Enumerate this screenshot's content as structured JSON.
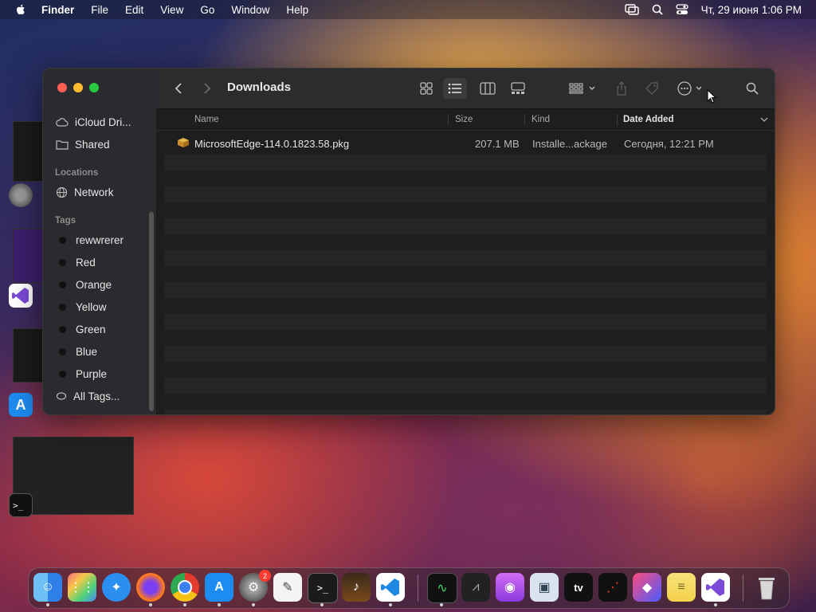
{
  "menubar": {
    "app_name": "Finder",
    "items": [
      "File",
      "Edit",
      "View",
      "Go",
      "Window",
      "Help"
    ],
    "clock": "Чт, 29 июня  1:06 PM"
  },
  "finder": {
    "title": "Downloads",
    "sidebar": {
      "favorites": [
        {
          "label": "iCloud Dri...",
          "icon": "cloud-icon"
        },
        {
          "label": "Shared",
          "icon": "shared-folder-icon"
        }
      ],
      "locations_header": "Locations",
      "locations": [
        {
          "label": "Network",
          "icon": "globe-icon"
        }
      ],
      "tags_header": "Tags",
      "tags": [
        {
          "label": "rewwrerer"
        },
        {
          "label": "Red"
        },
        {
          "label": "Orange"
        },
        {
          "label": "Yellow"
        },
        {
          "label": "Green"
        },
        {
          "label": "Blue"
        },
        {
          "label": "Purple"
        },
        {
          "label": "All Tags..."
        }
      ]
    },
    "columns": {
      "name": "Name",
      "size": "Size",
      "kind": "Kind",
      "date_added": "Date Added"
    },
    "files": [
      {
        "name": "MicrosoftEdge-114.0.1823.58.pkg",
        "size": "207.1 MB",
        "kind": "Installe...ackage",
        "date_added": "Сегодня, 12:21 PM"
      }
    ]
  },
  "dock": {
    "items": [
      "finder-icon",
      "launchpad-icon",
      "safari-icon",
      "firefox-icon",
      "chrome-icon",
      "app-store-icon",
      "system-settings-icon",
      "textedit-icon",
      "terminal-icon",
      "garageband-icon",
      "vscode-icon",
      "activity-monitor-icon",
      "stocks-icon",
      "podcasts-icon",
      "preview-icon",
      "apple-tv-icon",
      "voice-memos-icon",
      "shortcuts-icon",
      "notes-icon",
      "visual-studio-icon",
      "trash-icon"
    ],
    "badge": "2",
    "tv_label": "tv"
  }
}
